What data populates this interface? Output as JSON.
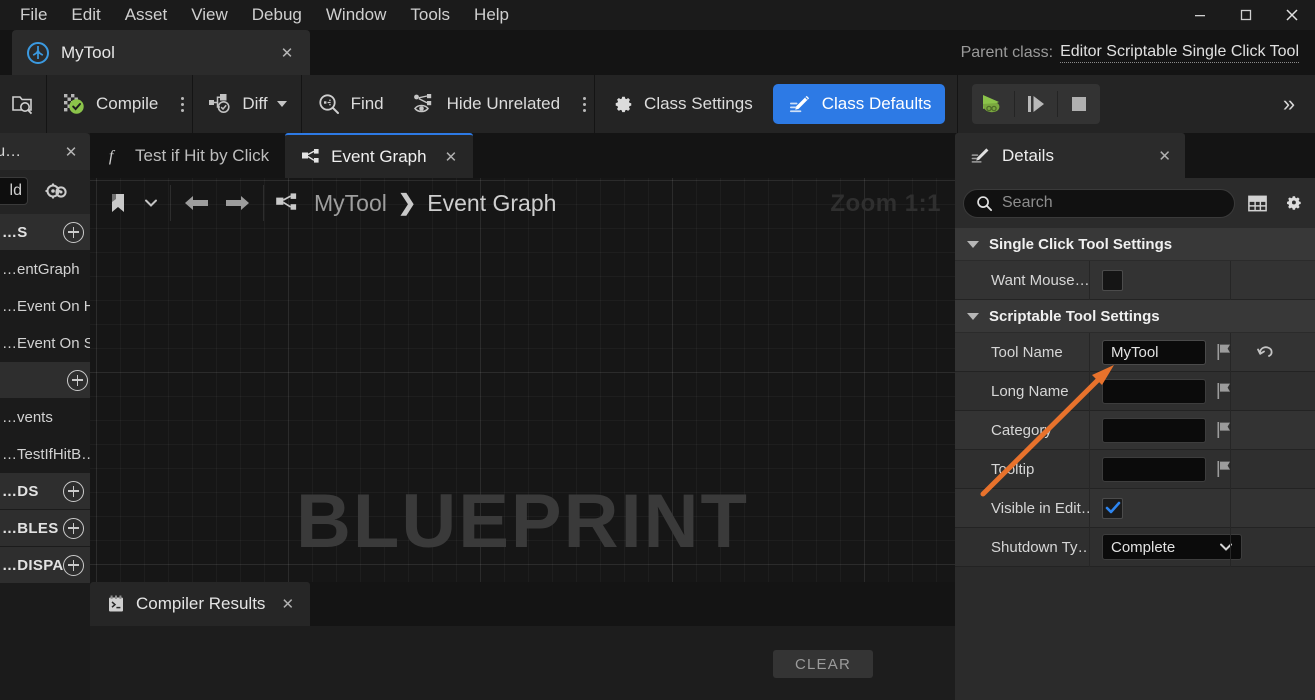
{
  "menubar": {
    "items": [
      {
        "label": "File"
      },
      {
        "label": "Edit"
      },
      {
        "label": "Asset"
      },
      {
        "label": "View"
      },
      {
        "label": "Debug"
      },
      {
        "label": "Window"
      },
      {
        "label": "Tools"
      },
      {
        "label": "Help"
      }
    ],
    "window_controls": [
      {
        "name": "minimize",
        "glyph": "—"
      },
      {
        "name": "maximize",
        "glyph": "□"
      },
      {
        "name": "close",
        "glyph": "✕"
      }
    ]
  },
  "asset_tab": {
    "title": "MyTool",
    "icon": "blueprint-icon",
    "close_glyph": "✕"
  },
  "parent_class": {
    "label": "Parent class:",
    "value": "Editor Scriptable Single Click Tool"
  },
  "toolbar": {
    "browse_icon": "browse-asset-icon",
    "compile_label": "Compile",
    "compile_icon": "compile-success-icon",
    "diff_label": "Diff",
    "diff_icon": "diff-icon",
    "find_label": "Find",
    "find_icon": "find-icon",
    "hide_unrelated_label": "Hide Unrelated",
    "hide_unrelated_icon": "hide-unrelated-icon",
    "class_settings_label": "Class Settings",
    "class_settings_icon": "gear-icon",
    "class_defaults_label": "Class Defaults",
    "class_defaults_icon": "pencil-edit-icon",
    "class_defaults_active": true,
    "play_icon": "play-simulate-icon",
    "step_icon": "step-forward-icon",
    "stop_icon": "stop-icon",
    "overflow_glyph": "»",
    "accent_color": "#2d7ae5",
    "play_green": "#8bc34a"
  },
  "left_panel": {
    "tab_label": "Blu…",
    "tab_close": "✕",
    "search_value": "ld",
    "settings_icon": "settings-gears-icon",
    "rows": [
      {
        "type": "header",
        "label": "…S",
        "has_plus": true
      },
      {
        "type": "item",
        "label": "…entGraph",
        "has_plus": false
      },
      {
        "type": "item",
        "label": "…Event On H…",
        "has_plus": false
      },
      {
        "type": "item",
        "label": "…Event On S…",
        "has_plus": false
      },
      {
        "type": "empty",
        "label": "",
        "has_plus": true
      },
      {
        "type": "item",
        "label": "…vents",
        "has_plus": false
      },
      {
        "type": "item",
        "label": "…TestIfHitB…",
        "has_plus": false
      },
      {
        "type": "header",
        "label": "…DS",
        "has_plus": true
      },
      {
        "type": "header",
        "label": "…BLES",
        "has_plus": true
      },
      {
        "type": "header",
        "label": "…DISPA…",
        "has_plus": true
      }
    ]
  },
  "graph_tabs": [
    {
      "label": "Test if Hit by Click",
      "icon": "function-icon",
      "active": false,
      "closable": false
    },
    {
      "label": "Event Graph",
      "icon": "event-graph-icon",
      "active": true,
      "closable": true,
      "close_glyph": "✕"
    }
  ],
  "graph": {
    "bookmark_icon": "bookmark-icon",
    "bookmark_chevron": "chevron-down-icon",
    "back_icon": "arrow-left-icon",
    "forward_icon": "arrow-right-icon",
    "graph_icon": "event-graph-icon",
    "breadcrumb": [
      "MyTool",
      "Event Graph"
    ],
    "breadcrumb_separator": "❯",
    "zoom_label": "Zoom 1:1",
    "watermark": "BLUEPRINT"
  },
  "compiler_results": {
    "tab_label": "Compiler Results",
    "tab_icon": "compiler-log-icon",
    "close_glyph": "✕",
    "clear_label": "CLEAR"
  },
  "details": {
    "tab_label": "Details",
    "tab_icon": "details-pencil-icon",
    "close_glyph": "✕",
    "search_placeholder": "Search",
    "search_icon": "search-icon",
    "columns_icon": "table-columns-icon",
    "settings_icon": "gear-icon",
    "categories": [
      {
        "name": "Single Click Tool Settings",
        "expanded": true,
        "properties": [
          {
            "label": "Want Mouse…",
            "control": "checkbox",
            "checked": false,
            "has_flag": false,
            "has_revert": false
          }
        ]
      },
      {
        "name": "Scriptable Tool Settings",
        "expanded": true,
        "properties": [
          {
            "label": "Tool Name",
            "control": "text",
            "value": "MyTool",
            "has_flag": true,
            "has_revert": true,
            "highlighted": true
          },
          {
            "label": "Long Name",
            "control": "text",
            "value": "",
            "has_flag": true,
            "has_revert": false
          },
          {
            "label": "Category",
            "control": "text",
            "value": "",
            "has_flag": true,
            "has_revert": false
          },
          {
            "label": "Tooltip",
            "control": "text",
            "value": "",
            "has_flag": true,
            "has_revert": false
          },
          {
            "label": "Visible in Edit…",
            "control": "checkbox",
            "checked": true,
            "has_flag": false,
            "has_revert": false
          },
          {
            "label": "Shutdown Ty…",
            "control": "select",
            "value": "Complete",
            "has_flag": false,
            "has_revert": false
          }
        ]
      }
    ]
  },
  "annotation": {
    "type": "arrow",
    "color": "#e8722c",
    "points": "from (985,390) to (1115,368)",
    "target": "tool-name-field"
  }
}
